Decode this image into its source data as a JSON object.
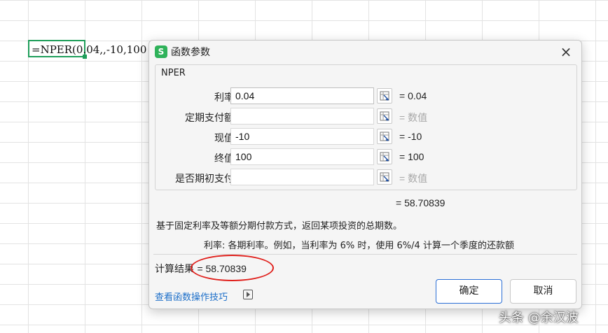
{
  "cell": {
    "formula": "=NPER(0.04,,-10,100"
  },
  "dialog": {
    "app_logo": "S",
    "title": "函数参数",
    "close_glyph": "×",
    "function_name": "NPER",
    "args": [
      {
        "label": "利率",
        "input": "0.04",
        "result": "= 0.04",
        "is_hint": false
      },
      {
        "label": "定期支付额",
        "input": "",
        "result": "= 数值",
        "is_hint": true
      },
      {
        "label": "现值",
        "input": "-10",
        "result": "= -10",
        "is_hint": false
      },
      {
        "label": "终值",
        "input": "100",
        "result": "= 100",
        "is_hint": false
      },
      {
        "label": "是否期初支付",
        "input": "",
        "result": "= 数值",
        "is_hint": true
      }
    ],
    "formula_result": "= 58.70839",
    "description": "基于固定利率及等额分期付款方式，返回某项投资的总期数。",
    "param_help": "利率:  各期利率。例如，当利率为 6% 时，使用 6%/4 计算一个季度的还款额",
    "calc_result_label": "计算结果",
    "calc_result_value": "= 58.70839",
    "help_link": "查看函数操作技巧",
    "ok_label": "确定",
    "cancel_label": "取消"
  },
  "watermark": "头条 @余汉波",
  "colors": {
    "accent_green": "#1f9e5a",
    "app_logo_green": "#2fb25a",
    "link_blue": "#1d6fc9",
    "ok_border_blue": "#2b6fd6",
    "annotation_red": "#e0201c"
  }
}
